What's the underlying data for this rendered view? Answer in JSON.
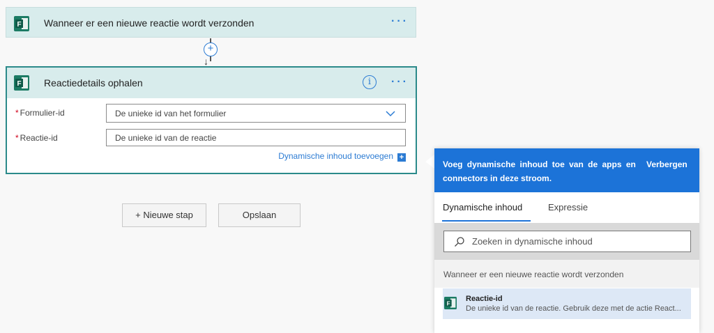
{
  "trigger": {
    "title": "Wanneer er een nieuwe reactie wordt verzonden",
    "more": "···"
  },
  "connector": {
    "add": "+",
    "arrow": "↓"
  },
  "action": {
    "title": "Reactiedetails ophalen",
    "info": "i",
    "more": "···",
    "fields": {
      "form_id": {
        "label": "Formulier-id",
        "placeholder": "De unieke id van het formulier"
      },
      "response_id": {
        "label": "Reactie-id",
        "placeholder": "De unieke id van de reactie"
      }
    },
    "required_mark": "*",
    "dynamic_link": "Dynamische inhoud toevoegen",
    "dynamic_plus": "+"
  },
  "buttons": {
    "new_step": "+ Nieuwe stap",
    "save": "Opslaan"
  },
  "panel": {
    "header_line1": "Voeg dynamische inhoud toe van de apps en",
    "header_line2": "connectors in deze stroom.",
    "hide": "Verbergen",
    "tabs": [
      "Dynamische inhoud",
      "Expressie"
    ],
    "search_placeholder": "Zoeken in dynamische inhoud",
    "section": "Wanneer er een nieuwe reactie wordt verzonden",
    "item": {
      "title": "Reactie-id",
      "description": "De unieke id van de reactie. Gebruik deze met de actie React..."
    }
  },
  "colors": {
    "accent": "#1c73d8",
    "forms": "#1c7b64",
    "header": "#d8ecec"
  }
}
